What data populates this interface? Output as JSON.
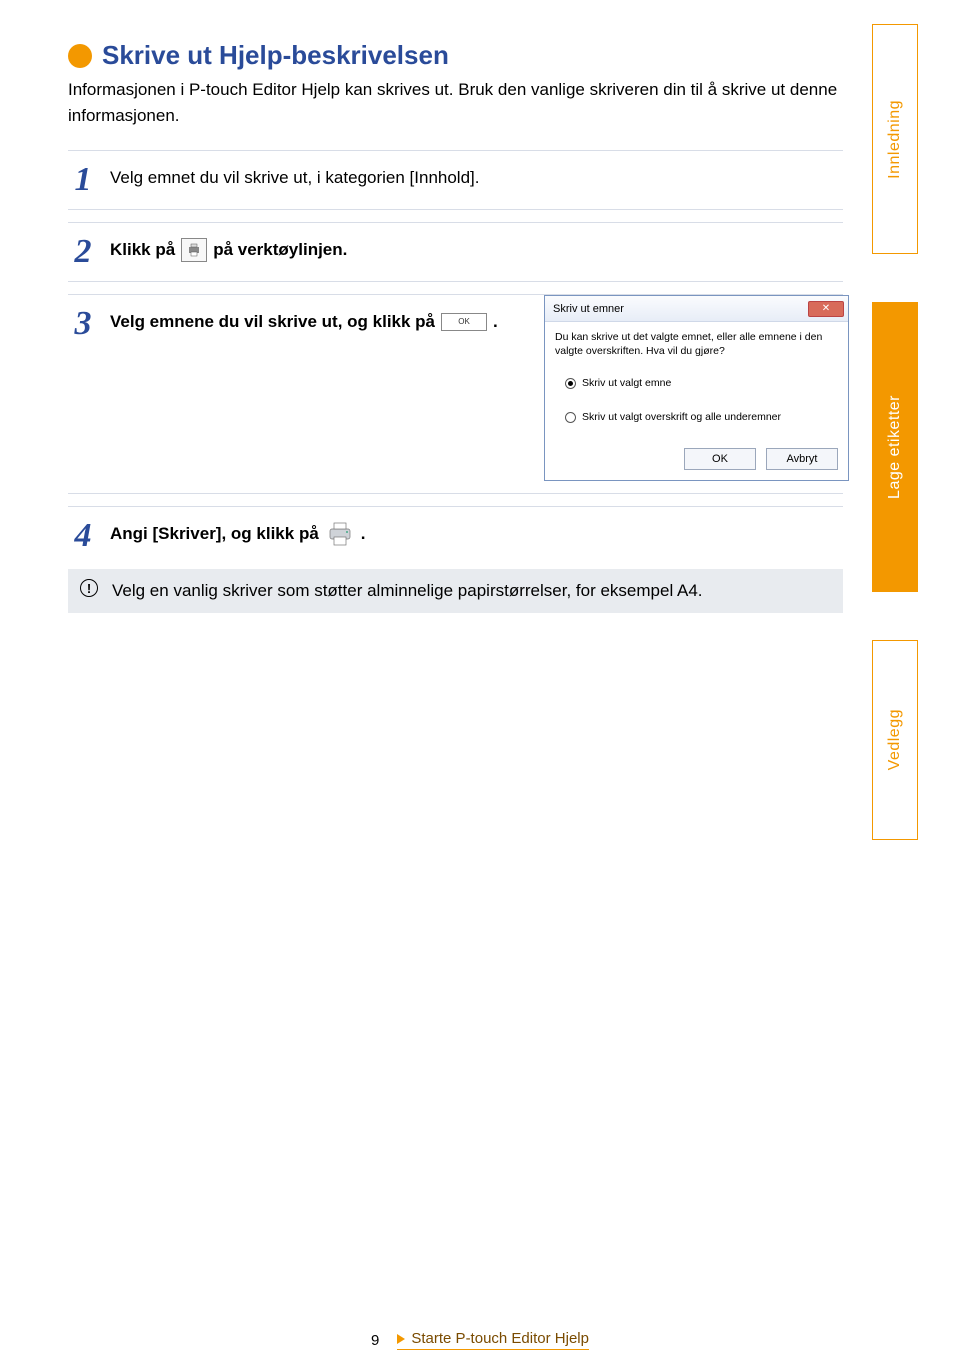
{
  "heading": "Skrive ut Hjelp-beskrivelsen",
  "intro": "Informasjonen i P-touch Editor Hjelp kan skrives ut. Bruk den vanlige skriveren din til å skrive ut denne informasjonen.",
  "steps": {
    "s1": {
      "num": "1",
      "text": "Velg emnet du vil skrive ut, i kategorien [Innhold]."
    },
    "s2": {
      "num": "2",
      "pre": "Klikk på",
      "post": " på verktøylinjen."
    },
    "s3": {
      "num": "3",
      "pre": "Velg emnene du vil skrive ut, og klikk på ",
      "post": "."
    },
    "s4": {
      "num": "4",
      "pre": "Angi [Skriver], og klikk på ",
      "post": "."
    }
  },
  "toolbar_icon_ok_label": "OK",
  "dialog": {
    "title": "Skriv ut emner",
    "text": "Du kan skrive ut det valgte emnet, eller alle emnene i den valgte overskriften. Hva vil du gjøre?",
    "radio1": "Skriv ut valgt emne",
    "radio2": "Skriv ut valgt overskrift og alle underemner",
    "ok": "OK",
    "cancel": "Avbryt"
  },
  "note": "Velg en vanlig skriver som støtter alminnelige papirstørrelser, for eksempel A4.",
  "tabs": {
    "t1": "Innledning",
    "t2": "Lage etiketter",
    "t3": "Vedlegg"
  },
  "footer": {
    "page": "9",
    "section": "Starte P-touch Editor Hjelp"
  }
}
